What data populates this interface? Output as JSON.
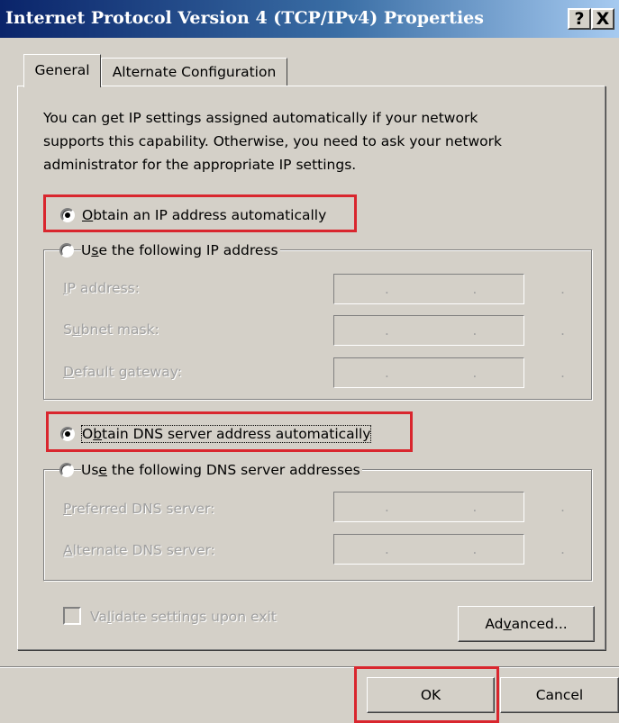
{
  "window": {
    "title": "Internet Protocol Version 4 (TCP/IPv4) Properties",
    "help_button": "?",
    "close_button": "X"
  },
  "tabs": [
    {
      "label": "General",
      "selected": true
    },
    {
      "label": "Alternate Configuration",
      "selected": false
    }
  ],
  "intro_lines": [
    "You can get IP settings assigned automatically if your network",
    "supports this capability. Otherwise, you need to ask your network",
    "administrator for the appropriate IP settings."
  ],
  "ip_section": {
    "auto_radio": {
      "prefix": "",
      "accel": "O",
      "rest": "btain an IP address automatically",
      "checked": true
    },
    "manual_radio": {
      "prefix": "U",
      "accel": "s",
      "rest": "e the following IP address",
      "checked": false
    },
    "fields": [
      {
        "prefix": "",
        "accel": "I",
        "rest": "P address:",
        "value": ". . ."
      },
      {
        "prefix": "S",
        "accel": "u",
        "rest": "bnet mask:",
        "value": ". . ."
      },
      {
        "prefix": "",
        "accel": "D",
        "rest": "efault gateway:",
        "value": ". . ."
      }
    ]
  },
  "dns_section": {
    "auto_radio": {
      "prefix": "O",
      "accel": "b",
      "rest": "tain DNS server address automatically",
      "checked": true
    },
    "manual_radio": {
      "prefix": "Us",
      "accel": "e",
      "rest": " the following DNS server addresses",
      "checked": false
    },
    "fields": [
      {
        "prefix": "",
        "accel": "P",
        "rest": "referred DNS server:",
        "value": ". . ."
      },
      {
        "prefix": "",
        "accel": "A",
        "rest": "lternate DNS server:",
        "value": ". . ."
      }
    ]
  },
  "validate_checkbox": {
    "prefix": "Va",
    "accel": "l",
    "rest": "idate settings upon exit",
    "checked": false
  },
  "buttons": {
    "advanced": {
      "prefix": "Ad",
      "accel": "v",
      "rest": "anced..."
    },
    "ok": "OK",
    "cancel": "Cancel"
  },
  "highlight_color": "#d9262e"
}
